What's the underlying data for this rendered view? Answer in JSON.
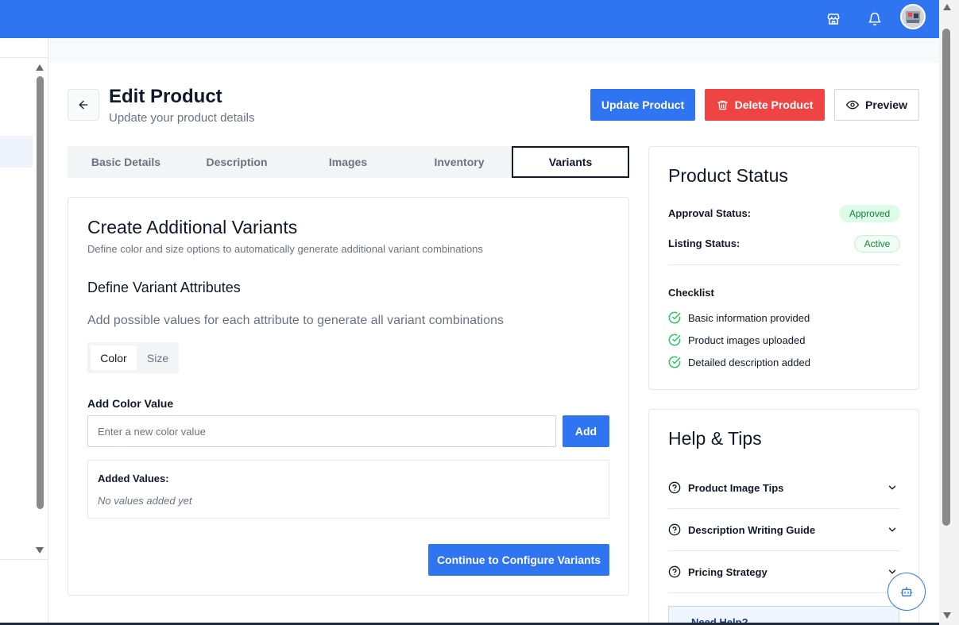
{
  "header": {
    "icons": [
      "store-icon",
      "bell-icon",
      "avatar"
    ]
  },
  "page": {
    "title": "Edit Product",
    "subtitle": "Update your product details",
    "buttons": {
      "update": "Update Product",
      "delete": "Delete Product",
      "preview": "Preview"
    }
  },
  "tabs": [
    {
      "label": "Basic Details",
      "active": false
    },
    {
      "label": "Description",
      "active": false
    },
    {
      "label": "Images",
      "active": false
    },
    {
      "label": "Inventory",
      "active": false
    },
    {
      "label": "Variants",
      "active": true
    }
  ],
  "variants": {
    "title": "Create Additional Variants",
    "subtitle": "Define color and size options to automatically generate additional variant combinations",
    "attributes_title": "Define Variant Attributes",
    "attributes_subtitle": "Add possible values for each attribute to generate all variant combinations",
    "attribute_tabs": [
      "Color",
      "Size"
    ],
    "active_attribute": "Color",
    "add_label": "Add Color Value",
    "input_placeholder": "Enter a new color value",
    "input_value": "",
    "add_button": "Add",
    "added_title": "Added Values:",
    "added_empty": "No values added yet",
    "continue_button": "Continue to Configure Variants"
  },
  "status": {
    "title": "Product Status",
    "approval_label": "Approval Status:",
    "approval_value": "Approved",
    "listing_label": "Listing Status:",
    "listing_value": "Active",
    "checklist_title": "Checklist",
    "checklist": [
      "Basic information provided",
      "Product images uploaded",
      "Detailed description added"
    ],
    "colors": {
      "success": "#22c55e",
      "badge_text": "#15803d"
    }
  },
  "help": {
    "title": "Help & Tips",
    "items": [
      "Product Image Tips",
      "Description Writing Guide",
      "Pricing Strategy"
    ],
    "need_help": "Need Help?"
  },
  "theme": {
    "primary": "#2f74f0",
    "danger": "#ef4444"
  }
}
